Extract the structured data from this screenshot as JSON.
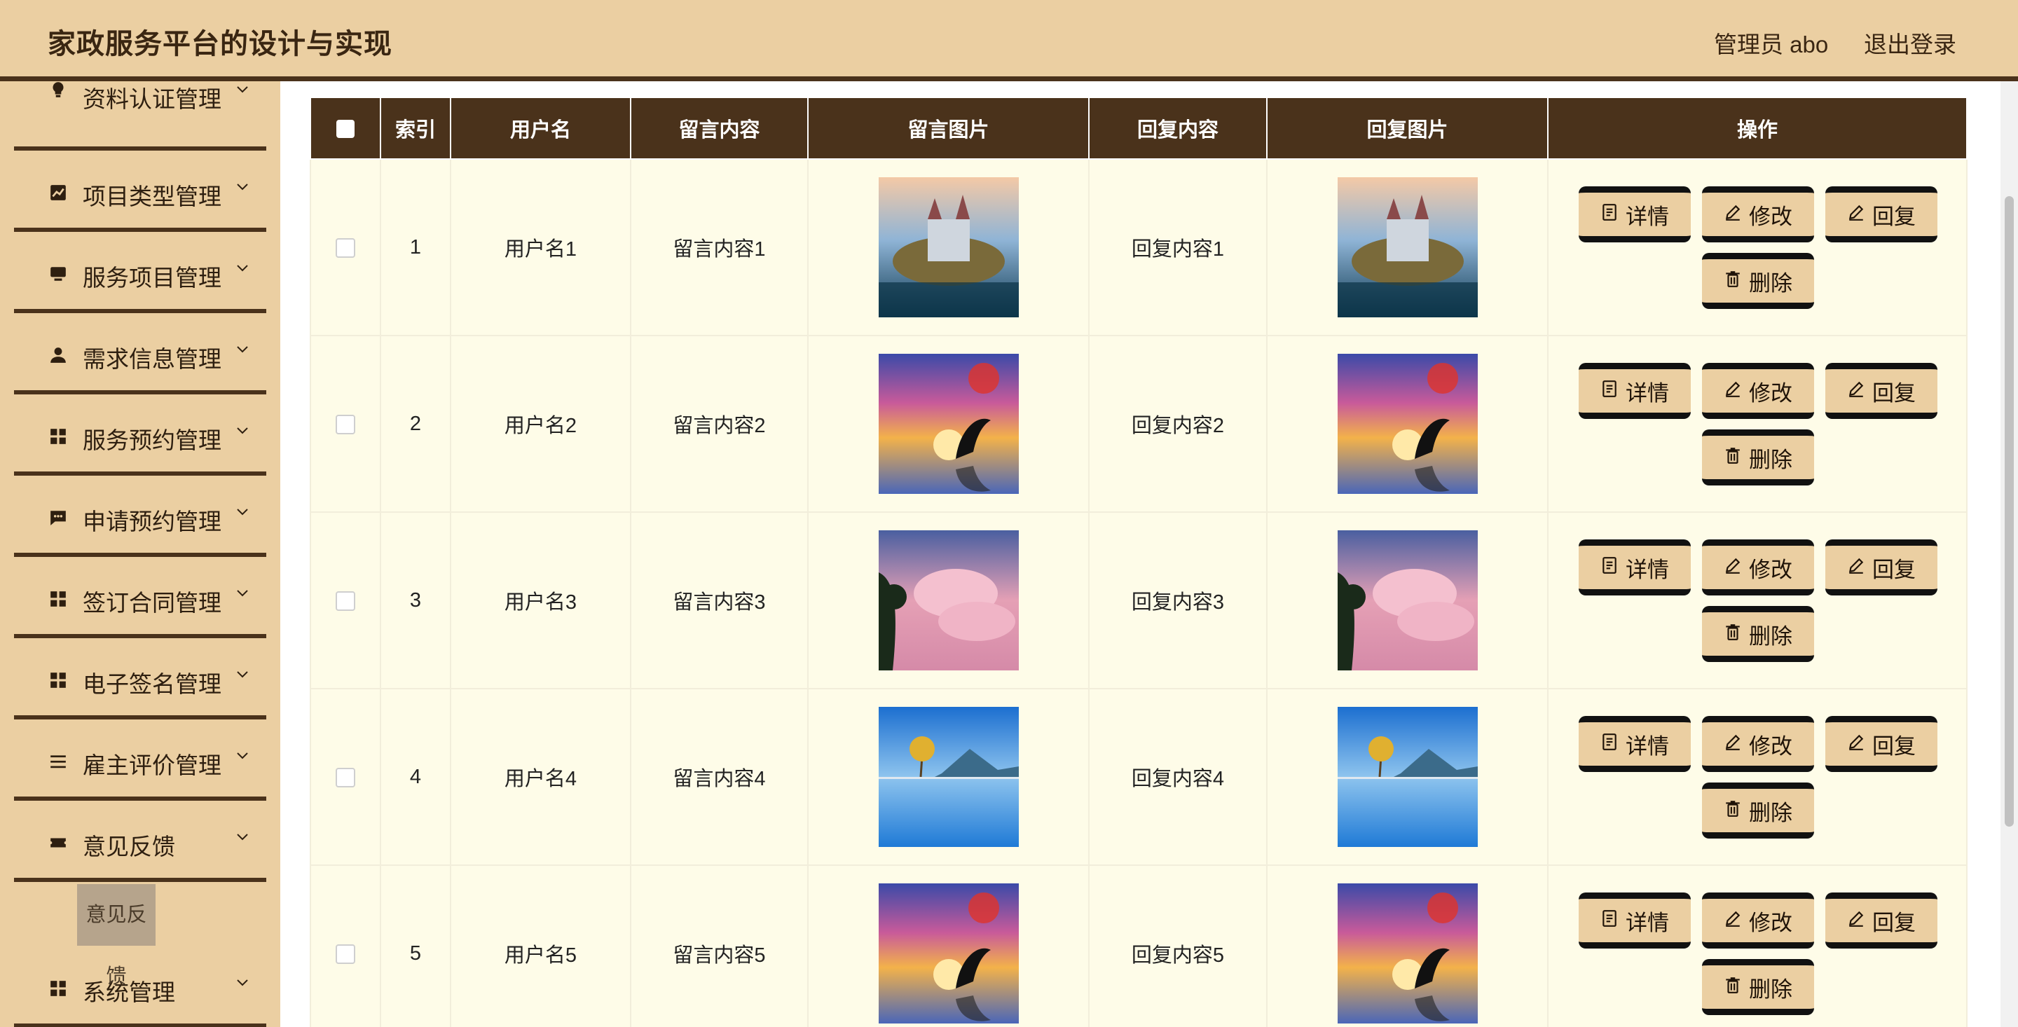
{
  "header": {
    "title": "家政服务平台的设计与实现",
    "admin": "管理员 abo",
    "logout": "退出登录"
  },
  "sidebar": {
    "menus": [
      {
        "label": "资料认证管理",
        "icon": "bulb-icon"
      },
      {
        "label": "项目类型管理",
        "icon": "chart-icon"
      },
      {
        "label": "服务项目管理",
        "icon": "monitor-icon"
      },
      {
        "label": "需求信息管理",
        "icon": "user-icon"
      },
      {
        "label": "服务预约管理",
        "icon": "grid-icon"
      },
      {
        "label": "申请预约管理",
        "icon": "chat-icon"
      },
      {
        "label": "签订合同管理",
        "icon": "grid-icon"
      },
      {
        "label": "电子签名管理",
        "icon": "grid-icon"
      },
      {
        "label": "雇主评价管理",
        "icon": "list-icon"
      },
      {
        "label": "意见反馈",
        "icon": "ticket-icon"
      },
      {
        "label": "系统管理",
        "icon": "grid-icon"
      }
    ],
    "active_submenu": "意见反馈"
  },
  "table": {
    "columns": [
      "索引",
      "用户名",
      "留言内容",
      "留言图片",
      "回复内容",
      "回复图片",
      "操作"
    ],
    "rows": [
      {
        "index": "1",
        "username": "用户名1",
        "message": "留言内容1",
        "reply": "回复内容1",
        "image": "castle-lake"
      },
      {
        "index": "2",
        "username": "用户名2",
        "message": "留言内容2",
        "reply": "回复内容2",
        "image": "dolphin-sunset"
      },
      {
        "index": "3",
        "username": "用户名3",
        "message": "留言内容3",
        "reply": "回复内容3",
        "image": "pink-clouds"
      },
      {
        "index": "4",
        "username": "用户名4",
        "message": "留言内容4",
        "reply": "回复内容4",
        "image": "tree-lake"
      },
      {
        "index": "5",
        "username": "用户名5",
        "message": "留言内容5",
        "reply": "回复内容5",
        "image": "dolphin-sunset"
      }
    ]
  },
  "actions": {
    "detail": "详情",
    "edit": "修改",
    "reply": "回复",
    "delete": "删除"
  },
  "colors": {
    "header_bg": "#ebcfa2",
    "accent_dark": "#4a321b",
    "row_bg": "#fefce8"
  }
}
